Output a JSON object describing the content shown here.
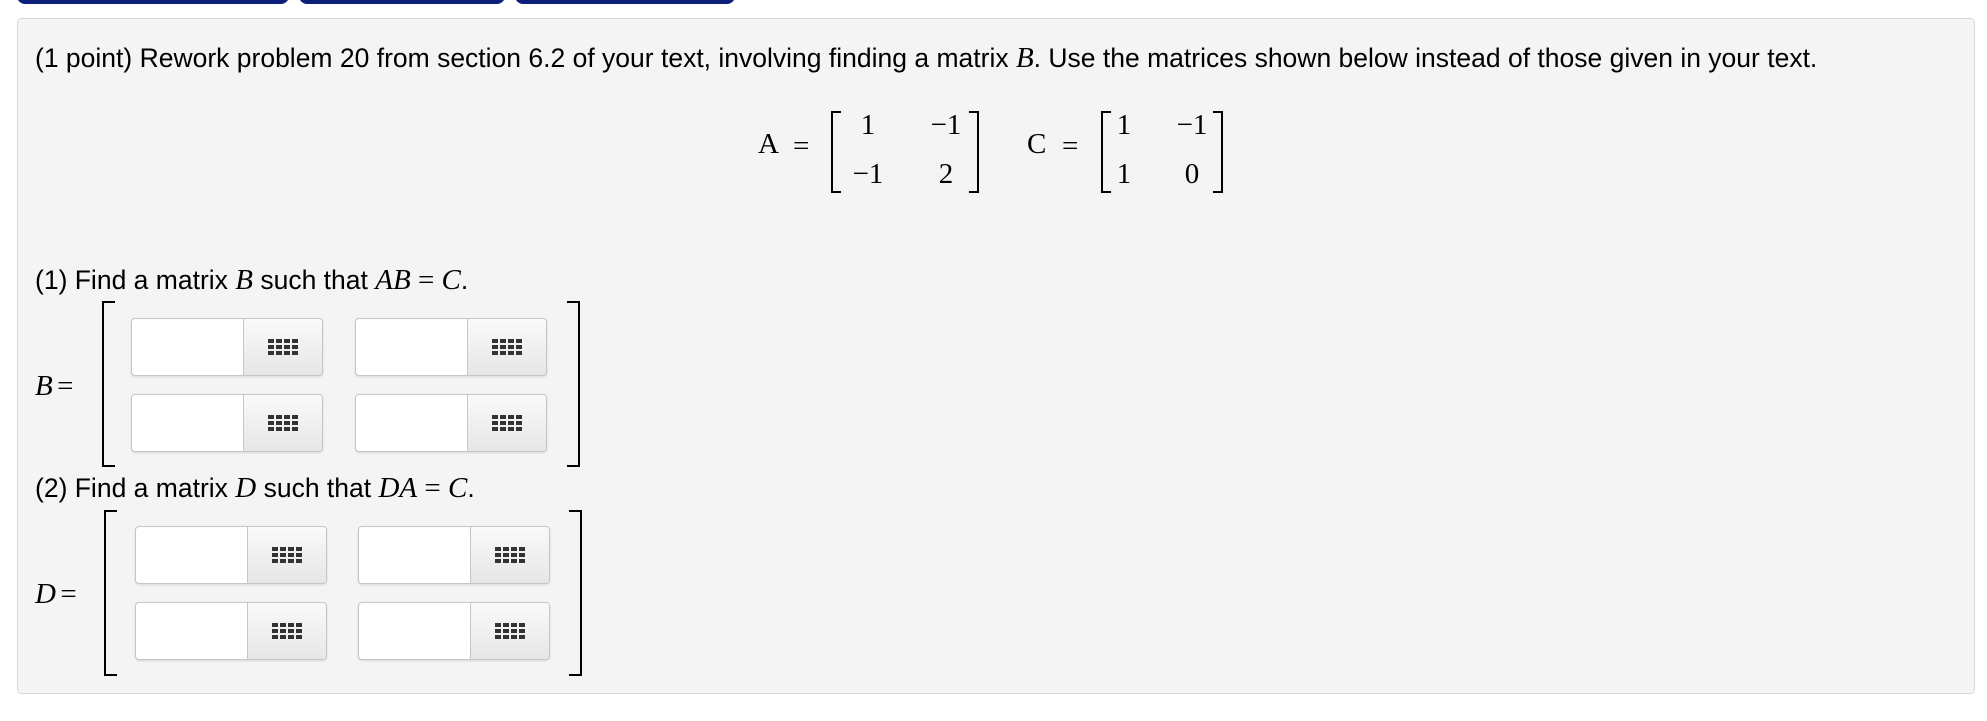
{
  "intro": {
    "prefix": "(1 point) Rework problem 20 from section 6.2 of your text, involving finding a matrix ",
    "var": "B",
    "suffix": ". Use the matrices shown below instead of those given in your text."
  },
  "matrices": {
    "A": {
      "name": "A",
      "eq": "=",
      "rows": [
        [
          "1",
          "−1"
        ],
        [
          "−1",
          "2"
        ]
      ]
    },
    "C": {
      "name": "C",
      "eq": "=",
      "rows": [
        [
          "1",
          "−1"
        ],
        [
          "1",
          "0"
        ]
      ]
    }
  },
  "part1": {
    "prefix": "(1) Find a matrix ",
    "var": "B",
    "mid": " such that ",
    "lhs": "AB",
    "eq": " = ",
    "rhs": "C",
    "end": ".",
    "label_var": "B",
    "label_eq": "="
  },
  "part2": {
    "prefix": "(2) Find a matrix ",
    "var": "D",
    "mid": " such that ",
    "lhs": "DA",
    "eq": " = ",
    "rhs": "C",
    "end": ".",
    "label_var": "D",
    "label_eq": "="
  },
  "answer_fields": {
    "B": [
      [
        "",
        ""
      ],
      [
        "",
        ""
      ]
    ],
    "D": [
      [
        "",
        ""
      ],
      [
        "",
        ""
      ]
    ]
  },
  "icons": {
    "matrix_entry_button": "grid-icon"
  },
  "colors": {
    "top_tabs": "#0c1f7a",
    "panel_background": "#f4f4f4"
  }
}
